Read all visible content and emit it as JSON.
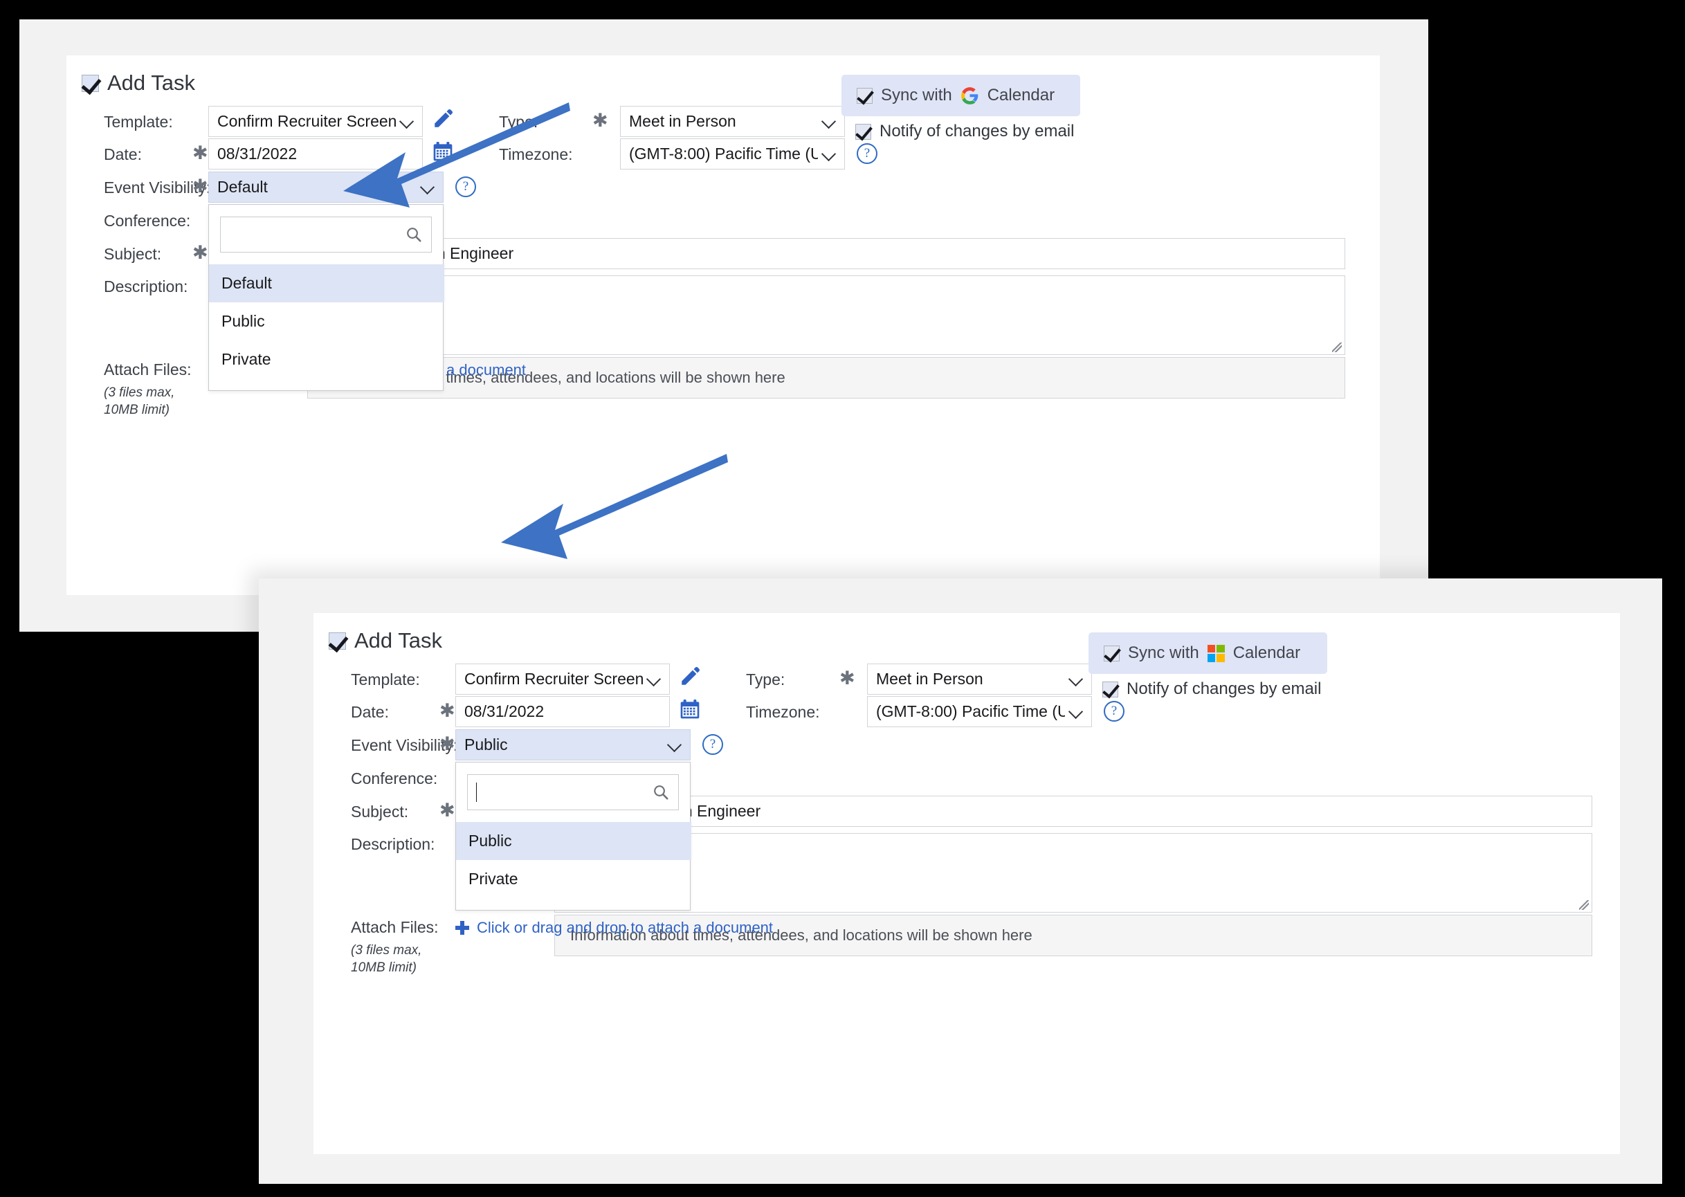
{
  "panels": [
    {
      "id": "top",
      "header": {
        "title": "Add Task"
      },
      "fields": {
        "template_label": "Template:",
        "template_value": "Confirm Recruiter Screen",
        "date_label": "Date:",
        "date_value": "08/31/2022",
        "event_visibility_label": "Event Visibility:",
        "event_visibility_value": "Default",
        "conference_label": "Conference:",
        "subject_label": "Subject:",
        "subject_value": "for QA Automation Engineer",
        "description_label": "Description:",
        "type_label": "Type:",
        "type_value": "Meet in Person",
        "timezone_label": "Timezone:",
        "timezone_value": "(GMT-8:00) Pacific Time (US",
        "required_mark": "✱"
      },
      "dropdown": {
        "search_value": "",
        "options": [
          "Default",
          "Public",
          "Private"
        ],
        "highlighted": "Default"
      },
      "sync": {
        "sync_label_before": "Sync with",
        "sync_label_after": "Calendar",
        "provider": "google",
        "notify_label": "Notify of changes by email"
      },
      "info_bar": "Information about times, attendees, and locations will be shown here",
      "attach": {
        "label": "Attach Files:",
        "link": "Click or drag and drop to attach a document",
        "note": "(3 files max,\n10MB limit)"
      }
    },
    {
      "id": "bottom",
      "header": {
        "title": "Add Task"
      },
      "fields": {
        "template_label": "Template:",
        "template_value": "Confirm Recruiter Screen",
        "date_label": "Date:",
        "date_value": "08/31/2022",
        "event_visibility_label": "Event Visibility:",
        "event_visibility_value": "Public",
        "conference_label": "Conference:",
        "subject_label": "Subject:",
        "subject_value": "for QA Automation Engineer",
        "description_label": "Description:",
        "type_label": "Type:",
        "type_value": "Meet in Person",
        "timezone_label": "Timezone:",
        "timezone_value": "(GMT-8:00) Pacific Time (US",
        "required_mark": "✱"
      },
      "dropdown": {
        "search_value": "",
        "options": [
          "Public",
          "Private"
        ],
        "highlighted": "Public"
      },
      "sync": {
        "sync_label_before": "Sync with",
        "sync_label_after": "Calendar",
        "provider": "microsoft",
        "notify_label": "Notify of changes by email"
      },
      "info_bar": "Information about times, attendees, and locations will be shown here",
      "attach": {
        "label": "Attach Files:",
        "link": "Click or drag and drop to attach a document",
        "note": "(3 files max,\n10MB limit)"
      }
    }
  ],
  "icons": {
    "pencil": "pencil-icon",
    "calendar": "calendar-icon",
    "help": "?",
    "search": "search-icon",
    "plus": "plus-icon",
    "chevron": "chevron-down-icon"
  },
  "colors": {
    "accent_blue": "#2f62c4",
    "arrow_blue": "#3d72c4",
    "selected_bg": "#dde4f5",
    "sync_bg": "#dfe4f6",
    "panel_bg": "#f2f2f2",
    "card_bg": "#ffffff",
    "backdrop": "#000000",
    "google_blue": "#4285f4",
    "google_red": "#ea4335",
    "google_yellow": "#fbbc05",
    "google_green": "#34a853",
    "ms_red": "#f25022",
    "ms_green": "#7fba00",
    "ms_blue": "#00a4ef",
    "ms_yellow": "#ffb900"
  },
  "annotation": {
    "arrows": 2,
    "description": "blue arrow pointing from timezone field down-left to the event visibility dropdown"
  }
}
